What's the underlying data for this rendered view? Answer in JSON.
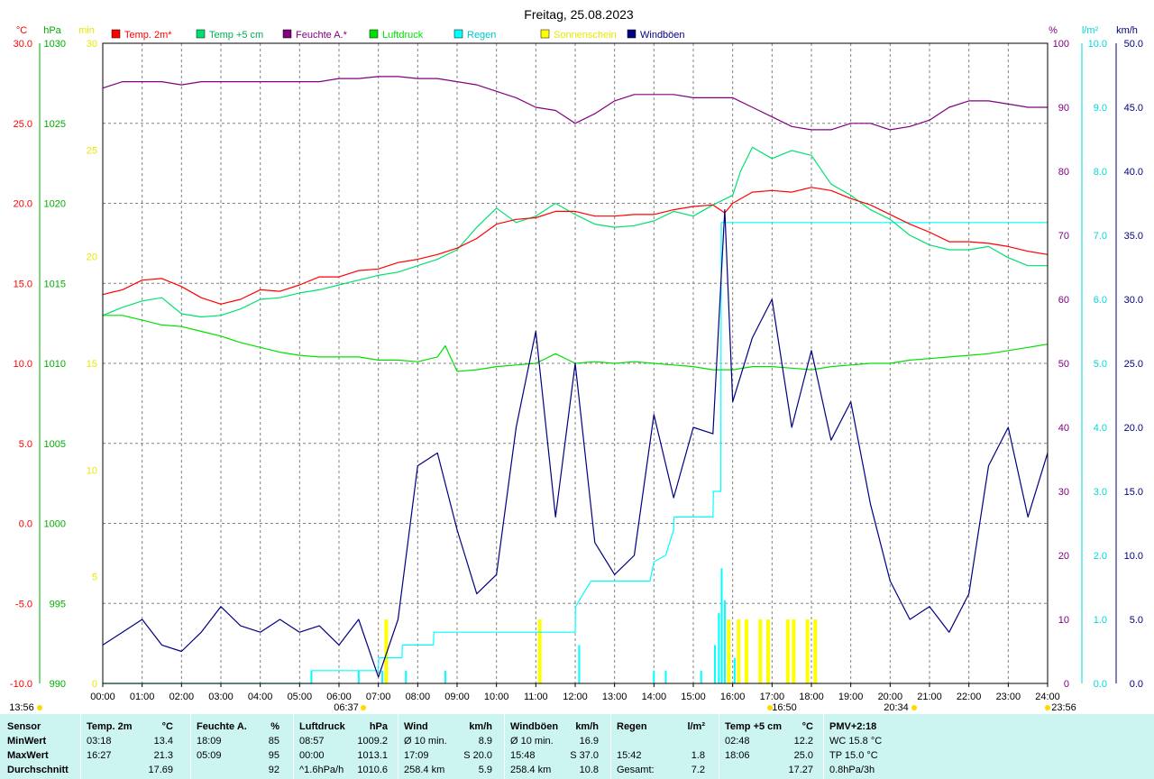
{
  "title": "Freitag, 25.08.2023",
  "axes": {
    "left": [
      {
        "unit": "°C",
        "color": "#ff0000",
        "ticks": [
          "30.0",
          "25.0",
          "20.0",
          "15.0",
          "10.0",
          "5.0",
          "0.0",
          "-5.0",
          "-10.0"
        ]
      },
      {
        "unit": "hPa",
        "color": "#00b000",
        "ticks": [
          "1030",
          "1025",
          "1020",
          "1015",
          "1010",
          "1005",
          "1000",
          "995",
          "990"
        ]
      },
      {
        "unit": "min",
        "color": "#e8e800",
        "ticks": [
          "30",
          "25",
          "20",
          "15",
          "10",
          "5",
          "0"
        ]
      }
    ],
    "right": [
      {
        "unit": "%",
        "color": "#800080",
        "ticks": [
          "100",
          "90",
          "80",
          "70",
          "60",
          "50",
          "40",
          "30",
          "20",
          "10",
          "0"
        ]
      },
      {
        "unit": "l/m²",
        "color": "#00d8d8",
        "ticks": [
          "10.0",
          "9.0",
          "8.0",
          "7.0",
          "6.0",
          "5.0",
          "4.0",
          "3.0",
          "2.0",
          "1.0",
          "0.0"
        ]
      },
      {
        "unit": "km/h",
        "color": "#000080",
        "ticks": [
          "50.0",
          "45.0",
          "40.0",
          "35.0",
          "30.0",
          "25.0",
          "20.0",
          "15.0",
          "10.0",
          "5.0",
          "0.0"
        ]
      }
    ],
    "x_ticks": [
      "00:00",
      "01:00",
      "02:00",
      "03:00",
      "04:00",
      "05:00",
      "06:00",
      "07:00",
      "08:00",
      "09:00",
      "10:00",
      "11:00",
      "12:00",
      "13:00",
      "14:00",
      "15:00",
      "16:00",
      "17:00",
      "18:00",
      "19:00",
      "20:00",
      "21:00",
      "22:00",
      "23:00",
      "24:00"
    ]
  },
  "sun_markers": {
    "time_left": "13:56",
    "sunrise": "06:37",
    "sun_peak": "16:50",
    "sunset": "20:34",
    "time_right": "23:56"
  },
  "legend": [
    {
      "label": "Temp. 2m*",
      "color": "#ff0000"
    },
    {
      "label": "Temp +5 cm",
      "color": "#00e070"
    },
    {
      "label": "Feuchte A.*",
      "color": "#800080"
    },
    {
      "label": "Luftdruck",
      "color": "#00e000"
    },
    {
      "label": "Regen",
      "color": "#00ffff"
    },
    {
      "label": "Sonnenschein",
      "color": "#ffff00"
    },
    {
      "label": "Windböen",
      "color": "#000080"
    }
  ],
  "colors": {
    "background": "#ffffff",
    "grid": "#808080",
    "footer_bg": "#ccf5f2"
  },
  "chart_data": {
    "type": "line",
    "x_range": [
      "00:00",
      "24:00"
    ],
    "ylim": {
      "temp": [
        -10,
        30
      ],
      "pressure": [
        990,
        1030
      ],
      "sun_min": [
        0,
        30
      ],
      "humidity": [
        0,
        100
      ],
      "rain": [
        0,
        10
      ],
      "wind": [
        0,
        50
      ]
    },
    "grid": true,
    "legend_position": "top",
    "series": [
      {
        "name": "Temp. 2m*",
        "axis": "temp",
        "color": "#ff0000",
        "x": [
          0,
          0.5,
          1,
          1.5,
          2,
          2.5,
          3,
          3.5,
          4,
          4.5,
          5,
          5.5,
          6,
          6.5,
          7,
          7.5,
          8,
          8.5,
          9,
          9.5,
          10,
          10.5,
          11,
          11.5,
          12,
          12.5,
          13,
          13.5,
          14,
          14.5,
          15,
          15.5,
          15.8,
          16,
          16.5,
          17,
          17.5,
          18,
          18.5,
          19,
          19.5,
          20,
          20.5,
          21,
          21.5,
          22,
          22.5,
          23,
          23.5,
          24
        ],
        "y": [
          14.3,
          14.6,
          15.2,
          15.3,
          14.8,
          14.1,
          13.7,
          14.0,
          14.6,
          14.5,
          14.9,
          15.4,
          15.4,
          15.8,
          15.9,
          16.3,
          16.5,
          16.8,
          17.2,
          17.8,
          18.7,
          19.0,
          19.1,
          19.5,
          19.5,
          19.2,
          19.2,
          19.3,
          19.3,
          19.6,
          19.8,
          19.9,
          19.4,
          20.0,
          20.7,
          20.8,
          20.7,
          21.0,
          20.8,
          20.3,
          19.9,
          19.3,
          18.7,
          18.2,
          17.6,
          17.6,
          17.5,
          17.3,
          17.0,
          16.8
        ]
      },
      {
        "name": "Temp +5 cm",
        "axis": "temp",
        "color": "#00e070",
        "x": [
          0,
          0.5,
          1,
          1.5,
          2,
          2.5,
          3,
          3.5,
          4,
          4.5,
          5,
          5.5,
          6,
          6.5,
          7,
          7.5,
          8,
          8.5,
          9,
          9.5,
          10,
          10.5,
          11,
          11.5,
          12,
          12.5,
          13,
          13.5,
          14,
          14.5,
          15,
          15.5,
          16,
          16.2,
          16.5,
          17,
          17.5,
          18,
          18.5,
          19,
          19.5,
          20,
          20.5,
          21,
          21.5,
          22,
          22.5,
          23,
          23.5,
          24
        ],
        "y": [
          13.0,
          13.5,
          13.9,
          14.1,
          13.1,
          12.9,
          13.0,
          13.4,
          14.0,
          14.1,
          14.4,
          14.6,
          14.9,
          15.2,
          15.5,
          15.7,
          16.1,
          16.5,
          17.1,
          18.5,
          19.7,
          18.8,
          19.2,
          20.0,
          19.3,
          18.7,
          18.5,
          18.6,
          18.9,
          19.5,
          19.2,
          19.9,
          20.5,
          22.0,
          23.5,
          22.8,
          23.3,
          23.0,
          21.2,
          20.5,
          19.6,
          19.0,
          18.0,
          17.4,
          17.1,
          17.1,
          17.3,
          16.6,
          16.1,
          16.1
        ]
      },
      {
        "name": "Feuchte A.*",
        "axis": "humidity",
        "color": "#800080",
        "x": [
          0,
          0.5,
          1,
          1.5,
          2,
          2.5,
          3,
          3.5,
          4,
          4.5,
          5,
          5.5,
          6,
          6.5,
          7,
          7.5,
          8,
          8.5,
          9,
          9.5,
          10,
          10.5,
          11,
          11.5,
          12,
          12.5,
          13,
          13.5,
          14,
          14.5,
          15,
          15.5,
          16,
          16.5,
          17,
          17.5,
          18,
          18.5,
          19,
          19.5,
          20,
          20.5,
          21,
          21.5,
          22,
          22.5,
          23,
          23.5,
          24
        ],
        "y": [
          93.0,
          94.0,
          94.0,
          94.0,
          93.5,
          94.0,
          94.0,
          94.0,
          94.0,
          94.0,
          94.0,
          94.0,
          94.5,
          94.5,
          94.8,
          94.8,
          94.5,
          94.5,
          94.0,
          93.5,
          92.5,
          91.5,
          90.0,
          89.5,
          87.5,
          89.0,
          91.0,
          92.0,
          92.0,
          92.0,
          91.5,
          91.5,
          91.5,
          90.0,
          88.5,
          87.0,
          86.5,
          86.5,
          87.5,
          87.5,
          86.5,
          87.0,
          88.0,
          90.0,
          91.0,
          91.0,
          90.5,
          90.0,
          90.0
        ]
      },
      {
        "name": "Luftdruck",
        "axis": "pressure",
        "color": "#00e000",
        "x": [
          0,
          0.5,
          1,
          1.5,
          2,
          2.5,
          3,
          3.5,
          4,
          4.5,
          5,
          5.5,
          6,
          6.5,
          7,
          7.5,
          8,
          8.5,
          8.7,
          9,
          9.5,
          10,
          10.5,
          11,
          11.5,
          12,
          12.5,
          13,
          13.5,
          14,
          14.5,
          15,
          15.5,
          16,
          16.5,
          17,
          17.5,
          18,
          18.5,
          19,
          19.5,
          20,
          20.5,
          21,
          21.5,
          22,
          22.5,
          23,
          23.5,
          24
        ],
        "y": [
          1013.0,
          1013.0,
          1012.7,
          1012.4,
          1012.3,
          1012.0,
          1011.7,
          1011.3,
          1011.0,
          1010.7,
          1010.5,
          1010.4,
          1010.4,
          1010.4,
          1010.2,
          1010.2,
          1010.1,
          1010.4,
          1011.1,
          1009.5,
          1009.6,
          1009.8,
          1009.9,
          1010.0,
          1010.6,
          1010.0,
          1010.1,
          1010.0,
          1010.1,
          1010.0,
          1009.9,
          1009.8,
          1009.6,
          1009.6,
          1009.8,
          1009.8,
          1009.7,
          1009.6,
          1009.8,
          1009.9,
          1010.0,
          1010.0,
          1010.2,
          1010.3,
          1010.4,
          1010.5,
          1010.6,
          1010.8,
          1011.0,
          1011.2
        ]
      },
      {
        "name": "Regen",
        "axis": "rain",
        "color": "#00ffff",
        "x": [
          0,
          5.3,
          5.31,
          7.0,
          7.01,
          7.6,
          7.61,
          8.4,
          8.41,
          9.1,
          9.11,
          12.0,
          12.01,
          12.4,
          12.41,
          13.9,
          14.0,
          14.3,
          14.5,
          14.51,
          15.5,
          15.51,
          15.7,
          15.71,
          24
        ],
        "y": [
          0,
          0,
          0.2,
          0.2,
          0.4,
          0.4,
          0.6,
          0.6,
          0.8,
          0.8,
          0.8,
          0.8,
          1.2,
          1.6,
          1.6,
          1.6,
          1.9,
          2.0,
          2.4,
          2.6,
          2.6,
          3.0,
          3.0,
          7.2,
          7.2
        ]
      },
      {
        "name": "Windböen",
        "axis": "wind",
        "color": "#000080",
        "x": [
          0,
          0.5,
          1,
          1.5,
          2,
          2.5,
          3,
          3.5,
          4,
          4.5,
          5,
          5.5,
          6,
          6.5,
          7,
          7.5,
          8,
          8.5,
          9,
          9.5,
          10,
          10.5,
          11,
          11.5,
          12,
          12.5,
          13,
          13.5,
          14,
          14.5,
          15,
          15.5,
          15.8,
          16,
          16.5,
          17,
          17.5,
          18,
          18.5,
          19,
          19.5,
          20,
          20.5,
          21,
          21.5,
          22,
          22.5,
          23,
          23.5,
          24
        ],
        "y": [
          3.0,
          4.0,
          5.0,
          3.0,
          2.5,
          4.0,
          6.0,
          4.5,
          4.0,
          5.0,
          4.0,
          4.5,
          3.0,
          5.0,
          0.5,
          5.0,
          17.0,
          18.0,
          12.0,
          7.0,
          8.5,
          20.0,
          27.5,
          13.0,
          25.0,
          11.0,
          8.5,
          10.0,
          21.0,
          14.5,
          20.0,
          19.5,
          37.0,
          22.0,
          27.0,
          30.0,
          20.0,
          26.0,
          19.0,
          22.0,
          14.0,
          8.0,
          5.0,
          6.0,
          4.0,
          7.0,
          17.0,
          20.0,
          13.0,
          18.0
        ]
      }
    ],
    "sunshine_bars": {
      "axis": "sun_min",
      "x": [
        7.2,
        11.1,
        15.9,
        16.15,
        16.35,
        16.7,
        16.9,
        17.4,
        17.55,
        17.9,
        18.1
      ],
      "y": [
        3,
        3,
        3,
        3,
        3,
        3,
        3,
        3,
        3,
        3,
        3
      ]
    },
    "rain_bars": {
      "axis": "rain",
      "x": [
        5.3,
        6.5,
        7.1,
        7.7,
        8.7,
        12.1,
        14.0,
        14.3,
        15.2,
        15.55,
        15.65,
        15.72,
        15.8,
        16.05
      ],
      "y": [
        0.2,
        0.2,
        0.2,
        0.2,
        0.2,
        0.6,
        0.2,
        0.2,
        0.2,
        0.6,
        1.1,
        1.8,
        1.3,
        0.4
      ]
    }
  },
  "footer": {
    "columns": [
      {
        "header": [
          "Sensor",
          ""
        ],
        "rows": [
          [
            "MinWert",
            ""
          ],
          [
            "MaxWert",
            ""
          ],
          [
            "Durchschnitt",
            ""
          ]
        ]
      },
      {
        "header": [
          "Temp. 2m",
          "°C"
        ],
        "rows": [
          [
            "03:18",
            "13.4"
          ],
          [
            "16:27",
            "21.3"
          ],
          [
            "",
            "17.69"
          ]
        ]
      },
      {
        "header": [
          "Feuchte A.",
          "%"
        ],
        "rows": [
          [
            "18:09",
            "85"
          ],
          [
            "05:09",
            "95"
          ],
          [
            "",
            "92"
          ]
        ]
      },
      {
        "header": [
          "Luftdruck",
          "hPa"
        ],
        "rows": [
          [
            "08:57",
            "1009.2"
          ],
          [
            "00:00",
            "1013.1"
          ],
          [
            "^1.6hPa/h",
            "1010.6"
          ]
        ]
      },
      {
        "header": [
          "Wind",
          "km/h"
        ],
        "rows": [
          [
            "Ø 10 min.",
            "8.9"
          ],
          [
            "17:09",
            "S 20.0"
          ],
          [
            "258.4 km",
            "5.9"
          ]
        ]
      },
      {
        "header": [
          "Windböen",
          "km/h"
        ],
        "rows": [
          [
            "Ø 10 min.",
            "16.9"
          ],
          [
            "15:48",
            "S 37.0"
          ],
          [
            "258.4 km",
            "10.8"
          ]
        ]
      },
      {
        "header": [
          "Regen",
          "l/m²"
        ],
        "rows": [
          [
            "",
            ""
          ],
          [
            "15:42",
            "1.8"
          ],
          [
            "Gesamt:",
            "7.2"
          ]
        ]
      },
      {
        "header": [
          "Temp +5 cm",
          "°C"
        ],
        "rows": [
          [
            "02:48",
            "12.2"
          ],
          [
            "18:06",
            "25.0"
          ],
          [
            "",
            "17.27"
          ]
        ]
      },
      {
        "header": [
          "PMV+2:18",
          ""
        ],
        "rows": [
          [
            "WC 15.8 °C",
            ""
          ],
          [
            "TP 15.0 °C",
            ""
          ],
          [
            "0.8hPa/3h",
            ""
          ]
        ]
      }
    ]
  }
}
